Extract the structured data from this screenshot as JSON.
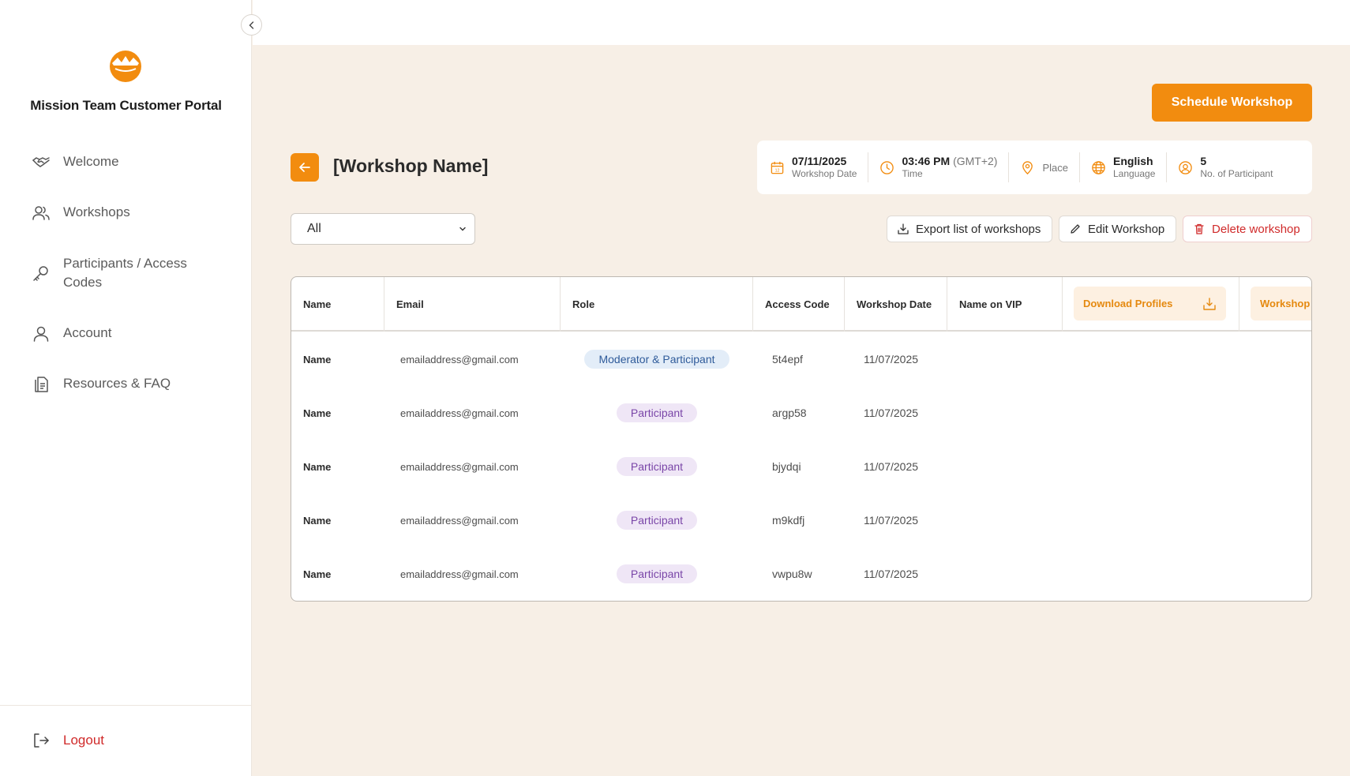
{
  "sidebar": {
    "title": "Mission Team Customer Portal",
    "items": [
      {
        "label": "Welcome",
        "icon": "handshake-icon"
      },
      {
        "label": "Workshops",
        "icon": "users-icon"
      },
      {
        "label": "Participants / Access Codes",
        "icon": "key-icon"
      },
      {
        "label": "Account",
        "icon": "user-icon"
      },
      {
        "label": "Resources & FAQ",
        "icon": "document-icon"
      }
    ],
    "logout": "Logout"
  },
  "header": {
    "schedule_button": "Schedule Workshop",
    "workshop_title": "[Workshop Name]"
  },
  "info": {
    "date_value": "07/11/2025",
    "date_label": "Workshop Date",
    "time_value": "03:46 PM",
    "time_zone": "(GMT+2)",
    "time_label": "Time",
    "place_label": "Place",
    "language_value": "English",
    "language_label": "Language",
    "participants_value": "5",
    "participants_label": "No. of Participant"
  },
  "filter": {
    "selected": "All"
  },
  "actions": {
    "export": "Export list of workshops",
    "edit": "Edit Workshop",
    "delete": "Delete workshop"
  },
  "table": {
    "headers": {
      "name": "Name",
      "email": "Email",
      "role": "Role",
      "access_code": "Access Code",
      "workshop_date": "Workshop Date",
      "name_on_vip": "Name on VIP",
      "download_profiles": "Download Profiles",
      "workshop": "Workshop"
    },
    "rows": [
      {
        "name": "Name",
        "email": "emailaddress@gmail.com",
        "role": "Moderator & Participant",
        "code": "5t4epf",
        "date": "11/07/2025"
      },
      {
        "name": "Name",
        "email": "emailaddress@gmail.com",
        "role": "Participant",
        "code": "argp58",
        "date": "11/07/2025"
      },
      {
        "name": "Name",
        "email": "emailaddress@gmail.com",
        "role": "Participant",
        "code": "bjydqi",
        "date": "11/07/2025"
      },
      {
        "name": "Name",
        "email": "emailaddress@gmail.com",
        "role": "Participant",
        "code": "m9kdfj",
        "date": "11/07/2025"
      },
      {
        "name": "Name",
        "email": "emailaddress@gmail.com",
        "role": "Participant",
        "code": "vwpu8w",
        "date": "11/07/2025"
      }
    ]
  },
  "colors": {
    "accent": "#f28c0f",
    "background": "#f7efe6",
    "danger": "#d02a2a",
    "moderator_pill": "#e3edf8",
    "participant_pill": "#efe6f6"
  }
}
